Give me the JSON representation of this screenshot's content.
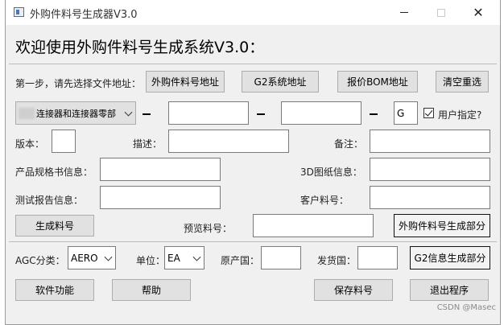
{
  "window": {
    "title": "外购件料号生成器V3.0",
    "minimize": "—",
    "close": "✕"
  },
  "heading": "欢迎使用外购件料号生成系统V3.0：",
  "step1": {
    "label": "第一步，请先选择文件地址：",
    "buttons": [
      "外购件料号地址",
      "G2系统地址",
      "报价BOM地址",
      "清空重选"
    ]
  },
  "code_row": {
    "category_value": "连接器和连接器零部",
    "field1": "",
    "field2": "",
    "suffix_value": "G",
    "user_specified_label": "用户指定?"
  },
  "fields": {
    "version_label": "版本：",
    "description_label": "描述：",
    "remark_label": "备注：",
    "spec_label": "产品规格书信息：",
    "drawing3d_label": "3D图纸信息：",
    "test_report_label": "测试报告信息：",
    "customer_pn_label": "客户料号："
  },
  "generate": {
    "button": "生成料号",
    "preview_label": "预览料号：",
    "section_button": "外购件料号生成部分"
  },
  "agc_row": {
    "agc_label": "AGC分类：",
    "agc_value": "AERO",
    "unit_label": "单位：",
    "unit_value": "EA",
    "origin_label": "原产国：",
    "ship_label": "发货国：",
    "section_button": "G2信息生成部分"
  },
  "footer": {
    "buttons": [
      "软件功能",
      "帮助",
      "保存料号",
      "退出程序"
    ]
  },
  "watermark": "CSDN @Masec"
}
